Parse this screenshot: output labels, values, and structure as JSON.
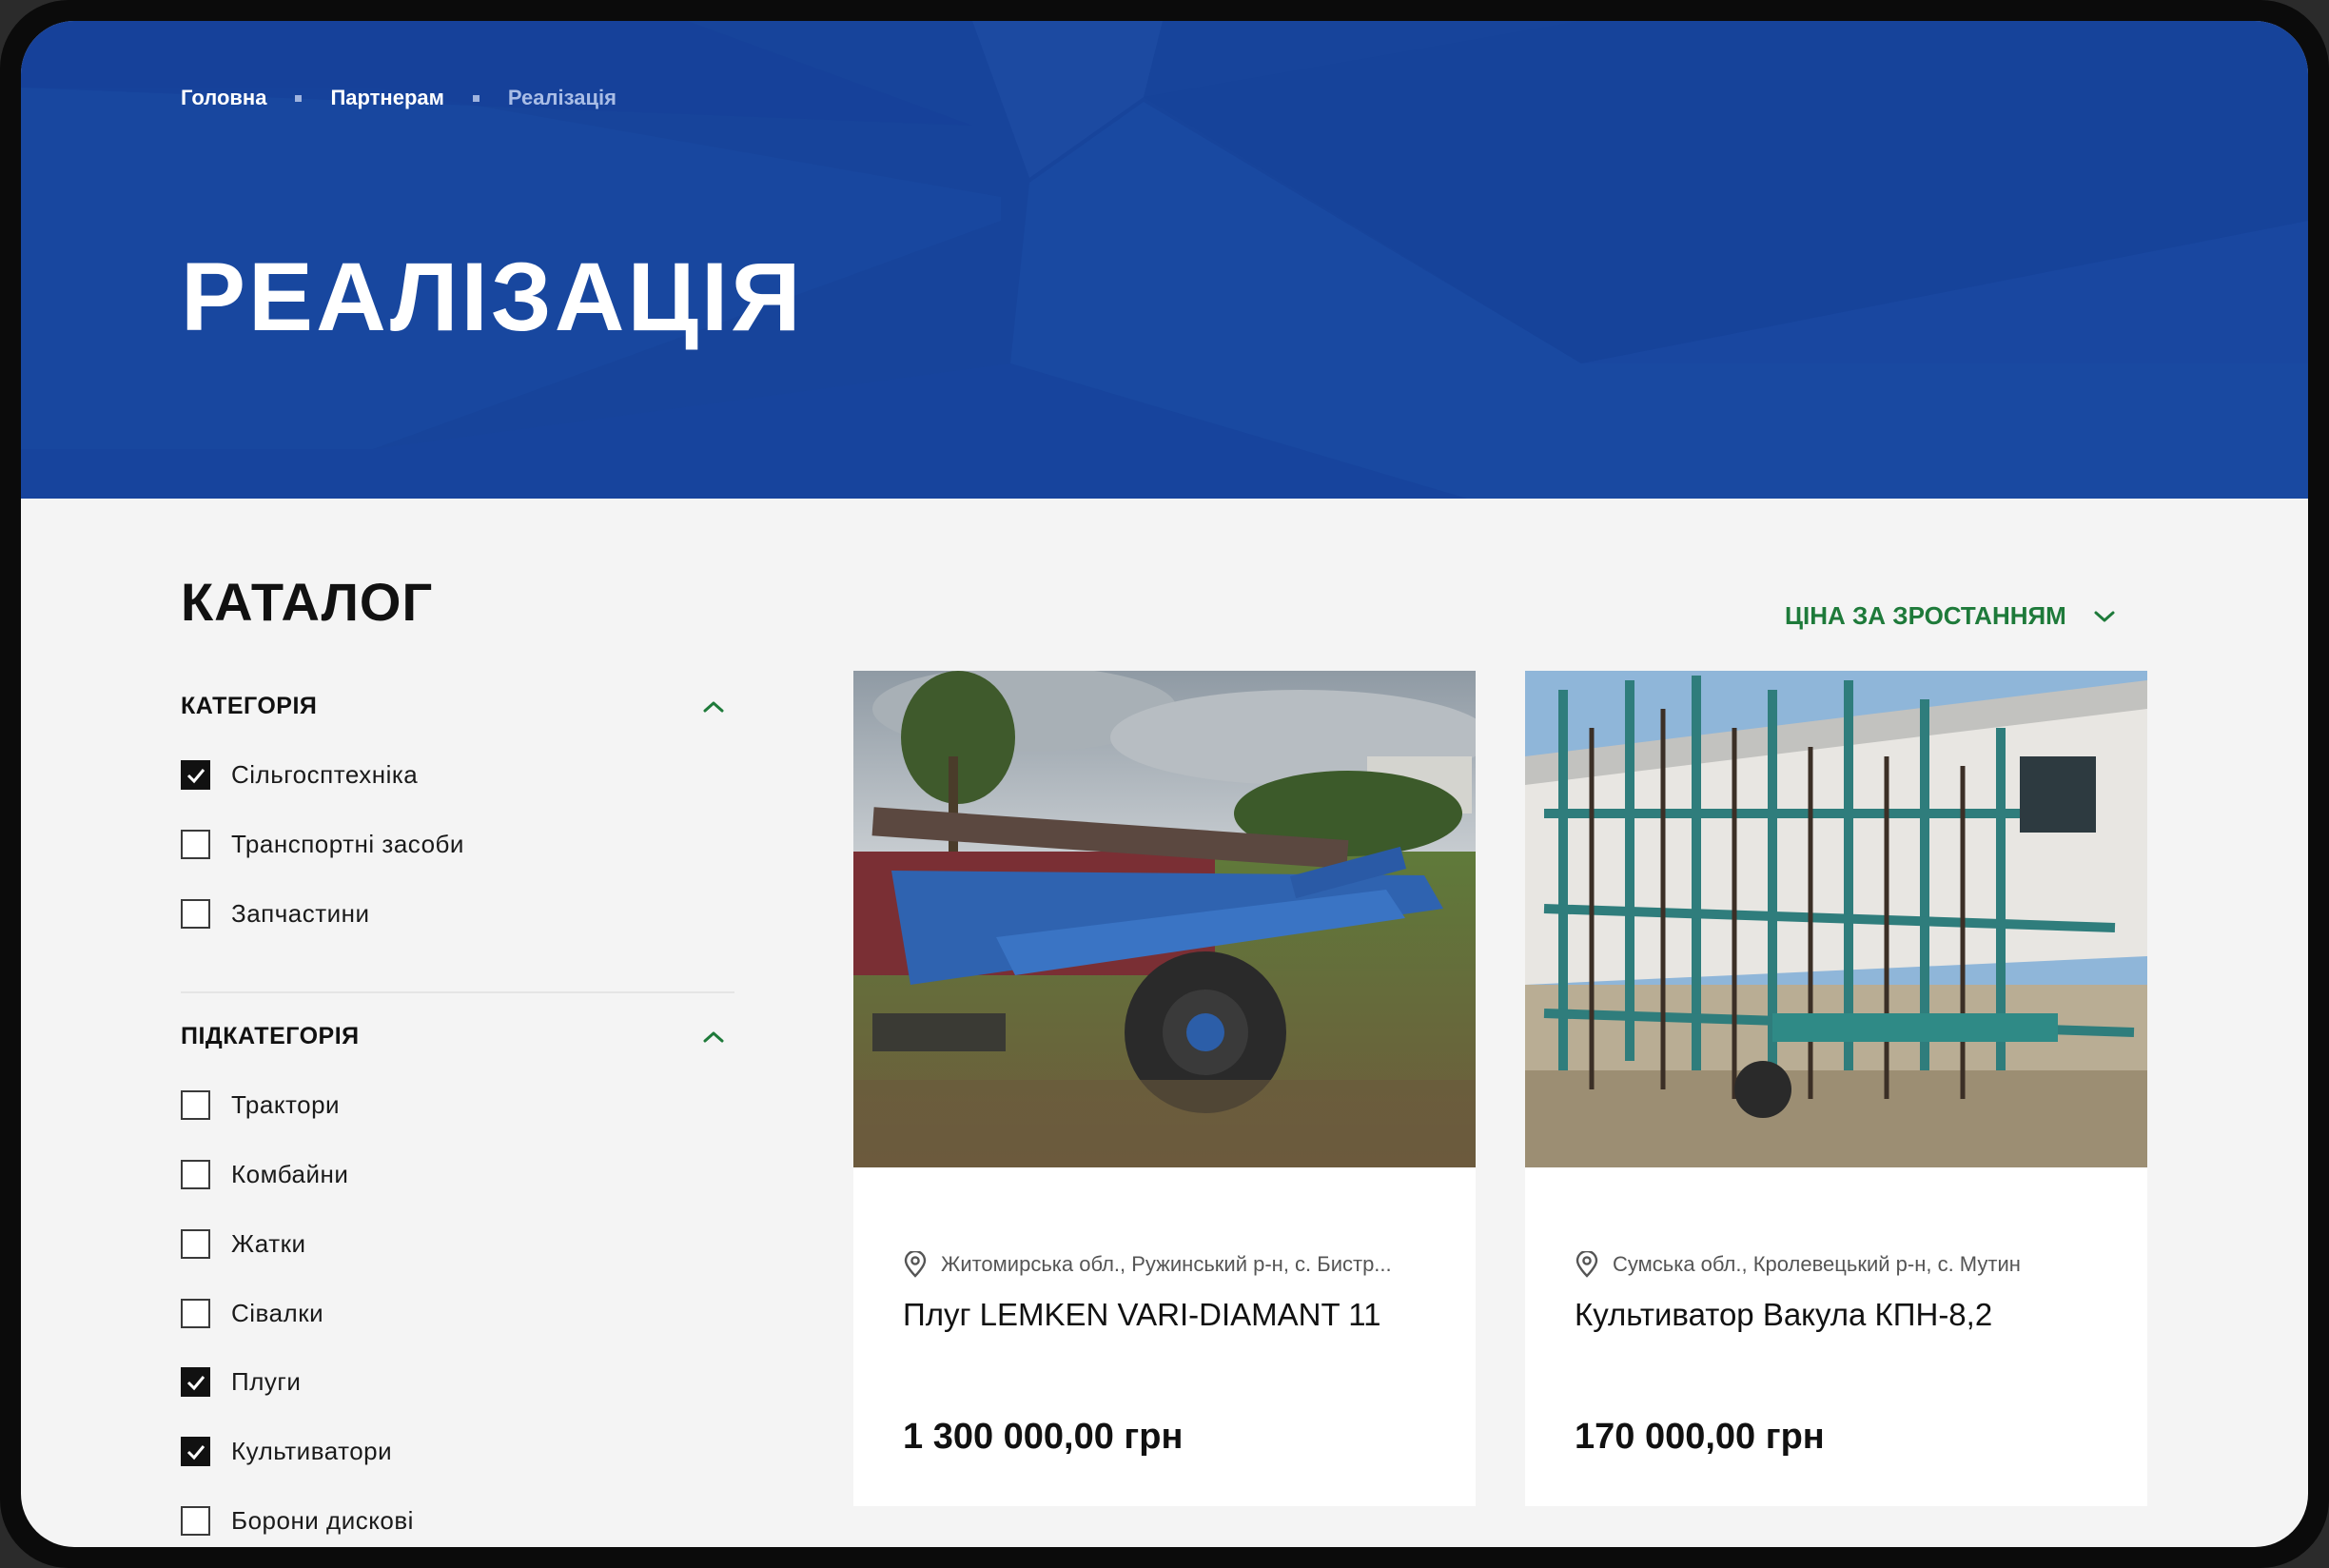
{
  "breadcrumb": {
    "home": "Головна",
    "partners": "Партнерам",
    "current": "Реалізація"
  },
  "hero": {
    "title": "РЕАЛІЗАЦІЯ",
    "background_color": "#17449b"
  },
  "catalog": {
    "title": "КАТАЛОГ",
    "sort_label": "ЦІНА ЗА ЗРОСТАННЯМ",
    "accent_color": "#1e7a3a"
  },
  "filters": {
    "category": {
      "title": "КАТЕГОРІЯ",
      "items": [
        {
          "label": "Сільгосптехніка",
          "checked": true
        },
        {
          "label": "Транспортні засоби",
          "checked": false
        },
        {
          "label": "Запчастини",
          "checked": false
        }
      ]
    },
    "subcategory": {
      "title": "ПІДКАТЕГОРІЯ",
      "items": [
        {
          "label": "Трактори",
          "checked": false
        },
        {
          "label": "Комбайни",
          "checked": false
        },
        {
          "label": "Жатки",
          "checked": false
        },
        {
          "label": "Сівалки",
          "checked": false
        },
        {
          "label": "Плуги",
          "checked": true
        },
        {
          "label": "Культиватори",
          "checked": true
        },
        {
          "label": "Борони дискові",
          "checked": false
        }
      ]
    }
  },
  "products": [
    {
      "location": "Житомирська обл., Ружинський р-н, с. Бистр...",
      "name": "Плуг LEMKEN VARI-DIAMANT 11",
      "price": "1 300 000,00 грн"
    },
    {
      "location": "Сумська обл., Кролевецький р-н, с. Мутин",
      "name": "Культиватор Вакула КПН-8,2",
      "price": "170 000,00 грн"
    }
  ]
}
